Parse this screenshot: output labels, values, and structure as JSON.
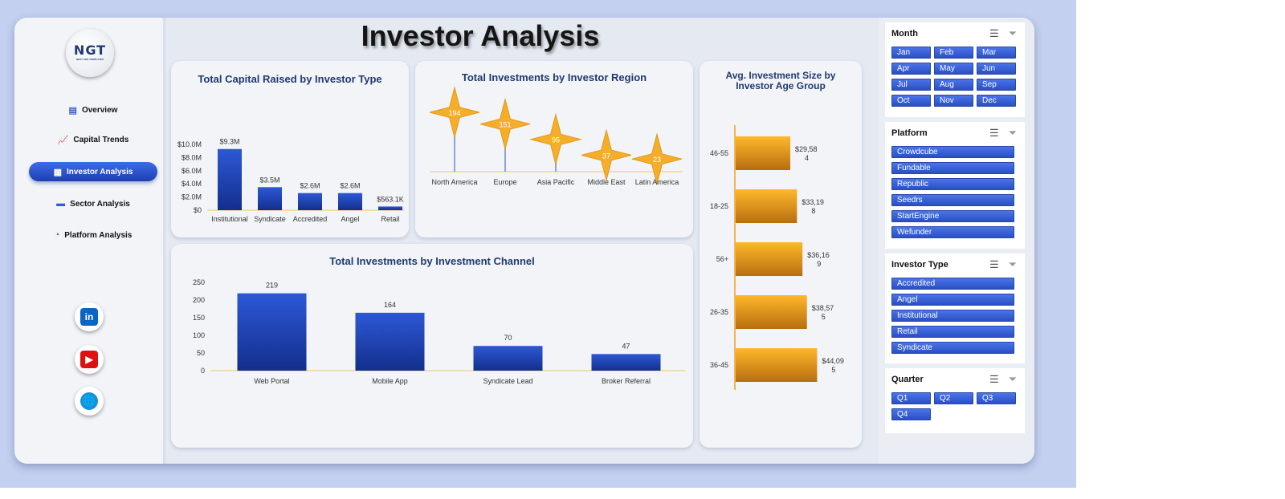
{
  "page": {
    "title": "Investor Analysis",
    "colors": {
      "background": "#c3d0ef",
      "bar_blue": "#1d3fb0",
      "bar_orange": "#f0a020",
      "nav_active": "#2a52d0"
    }
  },
  "logo": {
    "text": "NGT",
    "subtext": "NEXT GEN TEMPLATES"
  },
  "nav": [
    {
      "label": "Overview",
      "icon": "bar-chart-icon",
      "active": false
    },
    {
      "label": "Capital Trends",
      "icon": "line-chart-icon",
      "active": false
    },
    {
      "label": "Investor Analysis",
      "icon": "document-icon",
      "active": true
    },
    {
      "label": "Sector Analysis",
      "icon": "folder-icon",
      "active": false
    },
    {
      "label": "Platform Analysis",
      "icon": "pie-chart-icon",
      "active": false
    }
  ],
  "social": [
    {
      "name": "linkedin",
      "glyph": "in",
      "color": "#0a66c2"
    },
    {
      "name": "youtube",
      "glyph": "▶",
      "color": "#e01010"
    },
    {
      "name": "website",
      "glyph": "🌐",
      "color": "#1a8fd6"
    }
  ],
  "chart_data": [
    {
      "id": "capital-by-type",
      "type": "bar",
      "title": "Total Capital Raised by Investor Type",
      "categories": [
        "Institutional",
        "Syndicate",
        "Accredited",
        "Angel",
        "Retail"
      ],
      "values": [
        9.3,
        3.5,
        2.6,
        2.6,
        0.5631
      ],
      "data_labels": [
        "$9.3M",
        "$3.5M",
        "$2.6M",
        "$2.6M",
        "$563.1K"
      ],
      "ylim": [
        0,
        10
      ],
      "yticks": [
        "$0",
        "$2.0M",
        "$4.0M",
        "$6.0M",
        "$8.0M",
        "$10.0M"
      ],
      "ylabel": "",
      "xlabel": "",
      "grid": false
    },
    {
      "id": "investments-by-region",
      "type": "scatter",
      "marker": "star",
      "title": "Total Investments by Investor Region",
      "categories": [
        "North America",
        "Europe",
        "Asia Pacific",
        "Middle East",
        "Latin America"
      ],
      "values": [
        194,
        151,
        95,
        37,
        23
      ],
      "ylim": [
        0,
        200
      ],
      "grid": false
    },
    {
      "id": "investments-by-channel",
      "type": "bar",
      "title": "Total Investments by Investment Channel",
      "categories": [
        "Web Portal",
        "Mobile App",
        "Syndicate Lead",
        "Broker Referral"
      ],
      "values": [
        219,
        164,
        70,
        47
      ],
      "ylim": [
        0,
        250
      ],
      "yticks": [
        "0",
        "50",
        "100",
        "150",
        "200",
        "250"
      ],
      "grid": false
    },
    {
      "id": "avg-size-by-age",
      "type": "bar",
      "orientation": "horizontal",
      "title": "Avg. Investment Size by Investor Age Group",
      "categories": [
        "46-55",
        "18-25",
        "56+",
        "26-35",
        "36-45"
      ],
      "values": [
        29584,
        33198,
        36169,
        38575,
        44095
      ],
      "data_labels": [
        [
          "$29,58",
          "4"
        ],
        [
          "$33,19",
          "8"
        ],
        [
          "$36,16",
          "9"
        ],
        [
          "$38,57",
          "5"
        ],
        [
          "$44,09",
          "5"
        ]
      ],
      "xlim": [
        0,
        50000
      ],
      "grid": false
    }
  ],
  "slicers": [
    {
      "title": "Month",
      "cols": 3,
      "items": [
        "Jan",
        "Feb",
        "Mar",
        "Apr",
        "May",
        "Jun",
        "Jul",
        "Aug",
        "Sep",
        "Oct",
        "Nov",
        "Dec"
      ]
    },
    {
      "title": "Platform",
      "cols": 1,
      "items": [
        "Crowdcube",
        "Fundable",
        "Republic",
        "Seedrs",
        "StartEngine",
        "Wefunder"
      ]
    },
    {
      "title": "Investor Type",
      "cols": 1,
      "items": [
        "Accredited",
        "Angel",
        "Institutional",
        "Retail",
        "Syndicate"
      ]
    },
    {
      "title": "Quarter",
      "cols": 3,
      "items": [
        "Q1",
        "Q2",
        "Q3",
        "Q4"
      ]
    }
  ],
  "slicer_icons": {
    "multiselect": "multi-select-icon",
    "clear": "clear-filter-icon"
  }
}
